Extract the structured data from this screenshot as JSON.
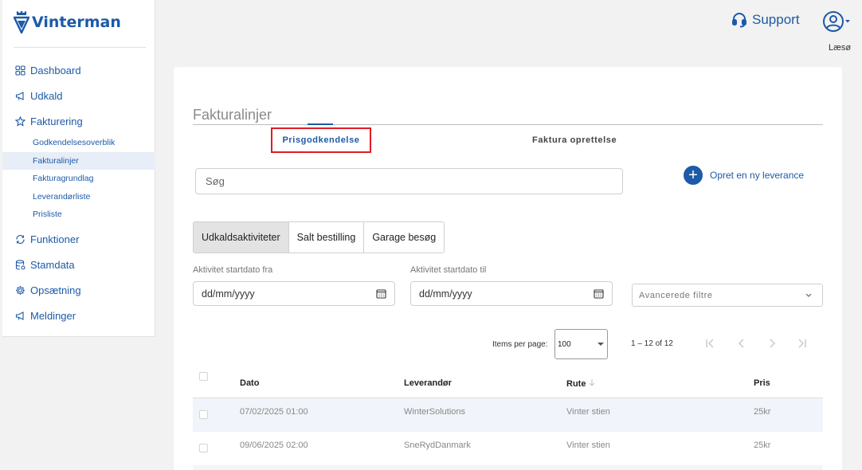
{
  "app": {
    "name": "Vinterman"
  },
  "sidebar": {
    "items": [
      {
        "label": "Dashboard"
      },
      {
        "label": "Udkald"
      },
      {
        "label": "Fakturering"
      }
    ],
    "sub_items": [
      {
        "label": "Godkendelsesoverblik"
      },
      {
        "label": "Fakturalinjer"
      },
      {
        "label": "Fakturagrundlag"
      },
      {
        "label": "Leverandørliste"
      },
      {
        "label": "Prisliste"
      }
    ],
    "items_after": [
      {
        "label": "Funktioner"
      },
      {
        "label": "Stamdata"
      },
      {
        "label": "Opsætning"
      },
      {
        "label": "Meldinger"
      }
    ]
  },
  "header": {
    "support_label": "Support",
    "user_label": "Læsø"
  },
  "main": {
    "title": "Fakturalinjer",
    "tabs": [
      {
        "label": "Prisgodkendelse"
      },
      {
        "label": "Faktura oprettelse"
      }
    ],
    "search_placeholder": "Søg",
    "new_delivery_label": "Opret en ny leverance",
    "segments": [
      {
        "label": "Udkaldsaktiviteter"
      },
      {
        "label": "Salt bestilling"
      },
      {
        "label": "Garage besøg"
      }
    ],
    "date_from_label": "Aktivitet startdato fra",
    "date_to_label": "Aktivitet startdato til",
    "date_placeholder": "dd/mm/yyyy",
    "advanced_filters_label": "Avancerede filtre",
    "pagination": {
      "items_per_page_label": "Items per page:",
      "page_size": "100",
      "range": "1 – 12 of 12"
    },
    "table": {
      "headers": {
        "date": "Dato",
        "supplier": "Leverandør",
        "route": "Rute",
        "price": "Pris"
      },
      "rows": [
        {
          "date": "07/02/2025 01:00",
          "supplier": "WinterSolutions",
          "route": "Vinter stien",
          "price": "25kr"
        },
        {
          "date": "09/06/2025 02:00",
          "supplier": "SneRydDanmark",
          "route": "Vinter stien",
          "price": "25kr"
        }
      ]
    }
  },
  "colors": {
    "accent": "#1d5aa8",
    "highlight": "#e01b24"
  }
}
